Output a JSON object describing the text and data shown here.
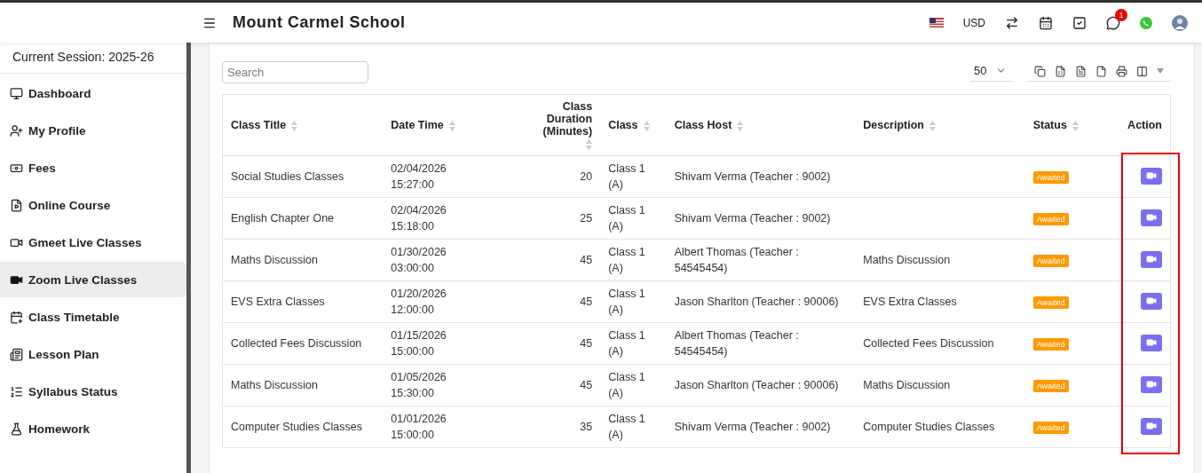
{
  "header": {
    "title": "Mount Carmel School",
    "currency": "USD",
    "notification_count": "1"
  },
  "sidebar": {
    "session": "Current Session: 2025-26",
    "items": [
      {
        "label": "Dashboard",
        "selected": false
      },
      {
        "label": "My Profile",
        "selected": false
      },
      {
        "label": "Fees",
        "selected": false
      },
      {
        "label": "Online Course",
        "selected": false
      },
      {
        "label": "Gmeet Live Classes",
        "selected": false
      },
      {
        "label": "Zoom Live Classes",
        "selected": true
      },
      {
        "label": "Class Timetable",
        "selected": false
      },
      {
        "label": "Lesson Plan",
        "selected": false
      },
      {
        "label": "Syllabus Status",
        "selected": false
      },
      {
        "label": "Homework",
        "selected": false
      }
    ]
  },
  "toolbar": {
    "search_placeholder": "Search",
    "page_size": "50"
  },
  "table": {
    "columns": [
      {
        "label": "Class Title",
        "sortable": true
      },
      {
        "label": "Date Time",
        "sortable": true
      },
      {
        "label": "Class Duration (Minutes)",
        "sortable": true
      },
      {
        "label": "Class",
        "sortable": true
      },
      {
        "label": "Class Host",
        "sortable": true
      },
      {
        "label": "Description",
        "sortable": true
      },
      {
        "label": "Status",
        "sortable": true
      },
      {
        "label": "Action",
        "sortable": false
      }
    ],
    "action_highlight": true,
    "rows": [
      {
        "title": "Social Studies Classes",
        "date": "02/04/2026",
        "time": "15:27:00",
        "duration": "20",
        "class": "Class 1",
        "section": "(A)",
        "host": "Shivam Verma (Teacher : 9002)",
        "description": "",
        "status": "Awaited"
      },
      {
        "title": "English Chapter One",
        "date": "02/04/2026",
        "time": "15:18:00",
        "duration": "25",
        "class": "Class 1",
        "section": "(A)",
        "host": "Shivam Verma (Teacher : 9002)",
        "description": "",
        "status": "Awaited"
      },
      {
        "title": "Maths Discussion",
        "date": "01/30/2026",
        "time": "03:00:00",
        "duration": "45",
        "class": "Class 1",
        "section": "(A)",
        "host": "Albert Thomas (Teacher : 54545454)",
        "description": "Maths Discussion",
        "status": "Awaited"
      },
      {
        "title": "EVS Extra Classes",
        "date": "01/20/2026",
        "time": "12:00:00",
        "duration": "45",
        "class": "Class 1",
        "section": "(A)",
        "host": "Jason Sharlton (Teacher : 90006)",
        "description": "EVS Extra Classes",
        "status": "Awaited"
      },
      {
        "title": "Collected Fees Discussion",
        "date": "01/15/2026",
        "time": "15:00:00",
        "duration": "45",
        "class": "Class 1",
        "section": "(A)",
        "host": "Albert Thomas (Teacher : 54545454)",
        "description": "Collected Fees Discussion",
        "status": "Awaited"
      },
      {
        "title": "Maths Discussion",
        "date": "01/05/2026",
        "time": "15:30:00",
        "duration": "45",
        "class": "Class 1",
        "section": "(A)",
        "host": "Jason Sharlton (Teacher : 90006)",
        "description": "Maths Discussion",
        "status": "Awaited"
      },
      {
        "title": "Computer Studies Classes",
        "date": "01/01/2026",
        "time": "15:00:00",
        "duration": "35",
        "class": "Class 1",
        "section": "(A)",
        "host": "Shivam Verma (Teacher : 9002)",
        "description": "Computer Studies Classes",
        "status": "Awaited"
      }
    ]
  }
}
